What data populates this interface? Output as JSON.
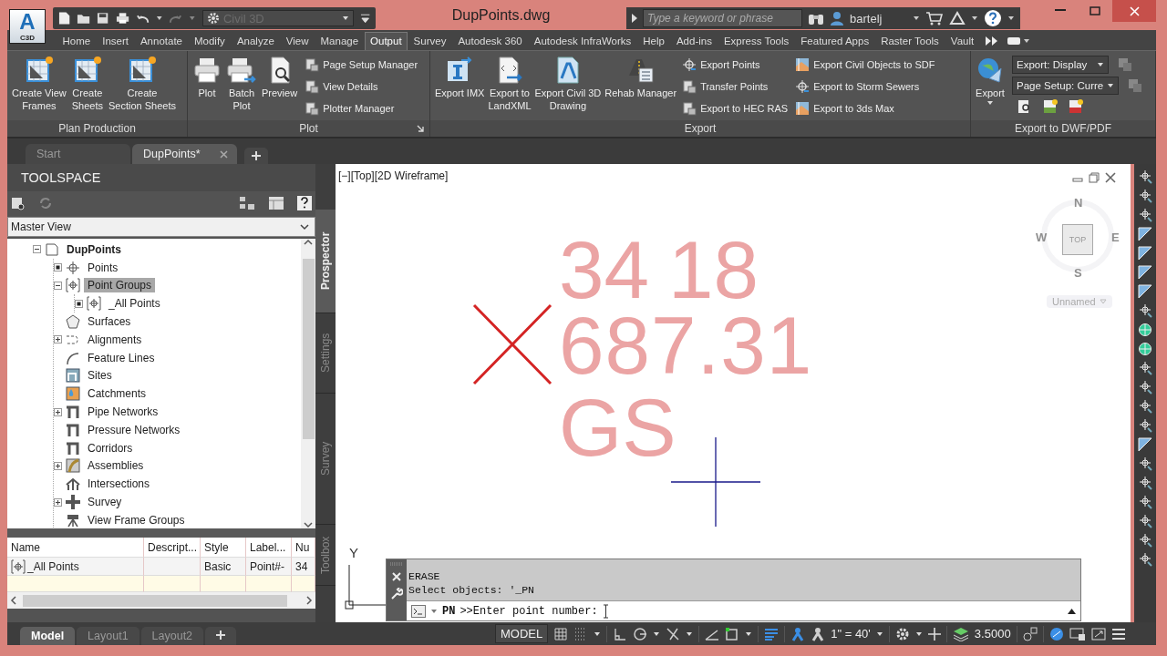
{
  "app_button": {
    "logo": "A",
    "label": "C3D"
  },
  "quick_access": {
    "workspace": "Civil 3D"
  },
  "title": "DupPoints.dwg",
  "search": {
    "placeholder": "Type a keyword or phrase"
  },
  "user": "bartelj",
  "ribbon_tabs": [
    {
      "label": "Home",
      "selected": false
    },
    {
      "label": "Insert",
      "selected": false
    },
    {
      "label": "Annotate",
      "selected": false
    },
    {
      "label": "Modify",
      "selected": false
    },
    {
      "label": "Analyze",
      "selected": false
    },
    {
      "label": "View",
      "selected": false
    },
    {
      "label": "Manage",
      "selected": false
    },
    {
      "label": "Output",
      "selected": true
    },
    {
      "label": "Survey",
      "selected": false
    },
    {
      "label": "Autodesk 360",
      "selected": false
    },
    {
      "label": "Autodesk InfraWorks",
      "selected": false
    },
    {
      "label": "Help",
      "selected": false
    },
    {
      "label": "Add-ins",
      "selected": false
    },
    {
      "label": "Express Tools",
      "selected": false
    },
    {
      "label": "Featured Apps",
      "selected": false
    },
    {
      "label": "Raster Tools",
      "selected": false
    },
    {
      "label": "Vault",
      "selected": false
    }
  ],
  "ribbon_panels": [
    {
      "title": "Plan Production",
      "launcher": false,
      "items": [
        {
          "kind": "large",
          "lines": [
            "Create View",
            "Frames"
          ]
        },
        {
          "kind": "large",
          "lines": [
            "Create",
            "Sheets"
          ]
        },
        {
          "kind": "large",
          "lines": [
            "Create",
            "Section Sheets"
          ]
        }
      ]
    },
    {
      "title": "Plot",
      "launcher": true,
      "items": [
        {
          "kind": "large",
          "lines": [
            "Plot"
          ]
        },
        {
          "kind": "large",
          "lines": [
            "Batch",
            "Plot"
          ]
        },
        {
          "kind": "large",
          "lines": [
            "Preview"
          ]
        },
        {
          "kind": "small",
          "label": "Page Setup Manager"
        },
        {
          "kind": "small",
          "label": "View Details"
        },
        {
          "kind": "small",
          "label": "Plotter Manager"
        }
      ]
    },
    {
      "title": "Export",
      "launcher": false,
      "items": [
        {
          "kind": "large",
          "lines": [
            "Export IMX"
          ]
        },
        {
          "kind": "large",
          "lines": [
            "Export to",
            "LandXML"
          ]
        },
        {
          "kind": "large",
          "lines": [
            "Export Civil 3D",
            "Drawing"
          ]
        },
        {
          "kind": "large",
          "lines": [
            "Rehab Manager"
          ]
        },
        {
          "kind": "small",
          "label": "Export Points"
        },
        {
          "kind": "small",
          "label": "Transfer Points"
        },
        {
          "kind": "small",
          "label": "Export to HEC RAS"
        },
        {
          "kind": "small",
          "label": "Export Civil Objects to SDF"
        },
        {
          "kind": "small",
          "label": "Export to Storm Sewers"
        },
        {
          "kind": "small",
          "label": "Export to 3ds Max"
        }
      ]
    },
    {
      "title": "Export to DWF/PDF",
      "launcher": false,
      "items": [
        {
          "kind": "large",
          "lines": [
            "Export"
          ]
        },
        {
          "kind": "dropdown",
          "value": "Export: Display"
        },
        {
          "kind": "dropdown",
          "value": "Page Setup: Curre"
        }
      ]
    }
  ],
  "doc_tabs": [
    {
      "label": "Start",
      "selected": false
    },
    {
      "label": "DupPoints*",
      "selected": true
    }
  ],
  "toolspace": {
    "title": "TOOLSPACE",
    "view": "Master View",
    "tree": [
      {
        "label": "DupPoints",
        "kind": "toggle",
        "expanded": true,
        "selected": false,
        "children": [
          {
            "label": "Points",
            "kind": "dot",
            "selected": false
          },
          {
            "label": "Point Groups",
            "kind": "toggle",
            "expanded": true,
            "selected": true,
            "children": [
              {
                "label": "_All Points",
                "kind": "dot",
                "selected": false
              }
            ]
          },
          {
            "label": "Surfaces",
            "kind": "plain",
            "selected": false
          },
          {
            "label": "Alignments",
            "kind": "toggle",
            "expanded": false,
            "selected": false
          },
          {
            "label": "Feature Lines",
            "kind": "plain",
            "selected": false
          },
          {
            "label": "Sites",
            "kind": "plain",
            "selected": false
          },
          {
            "label": "Catchments",
            "kind": "plain",
            "selected": false
          },
          {
            "label": "Pipe Networks",
            "kind": "toggle",
            "expanded": false,
            "selected": false
          },
          {
            "label": "Pressure Networks",
            "kind": "plain",
            "selected": false
          },
          {
            "label": "Corridors",
            "kind": "plain",
            "selected": false
          },
          {
            "label": "Assemblies",
            "kind": "toggle",
            "expanded": false,
            "selected": false
          },
          {
            "label": "Intersections",
            "kind": "plain",
            "selected": false
          },
          {
            "label": "Survey",
            "kind": "toggle",
            "expanded": false,
            "selected": false
          },
          {
            "label": "View Frame Groups",
            "kind": "plain",
            "selected": false
          }
        ]
      }
    ],
    "list": {
      "columns": [
        "Name",
        "Descript...",
        "Style",
        "Label...",
        "Nu"
      ],
      "rows": [
        {
          "name": "_All Points",
          "style": "Basic",
          "label": "Point#-",
          "number": "34"
        }
      ]
    },
    "side_tabs": [
      {
        "label": "Prospector",
        "selected": true
      },
      {
        "label": "Settings",
        "selected": false
      },
      {
        "label": "Survey",
        "selected": false
      },
      {
        "label": "Toolbox",
        "selected": false
      }
    ]
  },
  "viewport": {
    "controls": [
      "[−]",
      "[Top]",
      "[2D Wireframe]"
    ],
    "viewcube": {
      "north": "N",
      "south": "S",
      "east": "E",
      "west": "W",
      "face": "TOP",
      "ucs": "Unnamed"
    },
    "point_label": {
      "numbers": [
        "34",
        "18"
      ],
      "elevation": "687.31",
      "description": "GS"
    },
    "ucs_axis": "Y"
  },
  "command_line": {
    "history": [
      "ERASE",
      "Select objects: '_PN"
    ],
    "command": "PN",
    "prompt": ">>Enter point number:"
  },
  "layout_tabs": [
    {
      "label": "Model",
      "selected": true
    },
    {
      "label": "Layout1",
      "selected": false
    },
    {
      "label": "Layout2",
      "selected": false
    }
  ],
  "status_bar": {
    "mode": "MODEL",
    "scale": "1\" = 40'",
    "value": "3.5000",
    "toggles": [
      {
        "on": false
      },
      {
        "on": false
      },
      {
        "on": false
      },
      {
        "on": false
      },
      {
        "on": false
      },
      {
        "on": false
      },
      {
        "on": false
      },
      {
        "on": true
      },
      {
        "on": true
      },
      {
        "on": false
      },
      {
        "on": false
      },
      {
        "on": true
      }
    ]
  }
}
